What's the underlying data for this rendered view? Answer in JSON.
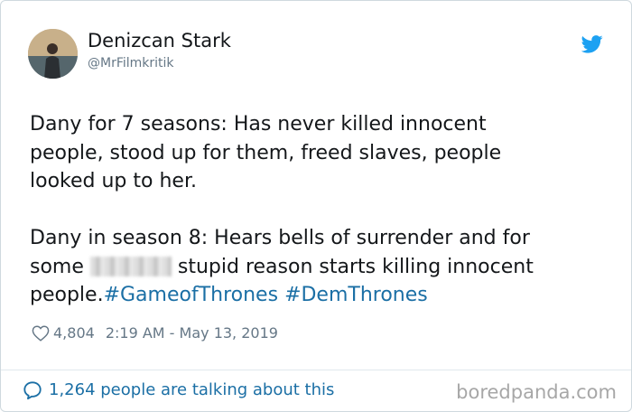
{
  "author": {
    "display_name": "Denizcan Stark",
    "handle": "@MrFilmkritik"
  },
  "tweet": {
    "lines": [
      "Dany for 7 seasons: Has never killed innocent",
      "people, stood up for them, freed slaves, people",
      "looked up to her.",
      "Dany in season 8: Hears bells of surrender and for",
      "some",
      "stupid reason starts killing innocent",
      "people."
    ],
    "hashtags": [
      "#GameofThrones",
      "#DemThrones"
    ]
  },
  "meta": {
    "likes": "4,804",
    "timestamp": "2:19 AM - May 13, 2019"
  },
  "footer": {
    "talking": "1,264 people are talking about this"
  },
  "watermark": "boredpanda.com",
  "icons": {
    "logo": "twitter-bird-icon",
    "like": "heart-icon",
    "conversation": "chat-bubble-icon"
  },
  "colors": {
    "accent": "#1da1f2",
    "link": "#1b6fa5",
    "text": "#14171a",
    "muted": "#657786"
  }
}
